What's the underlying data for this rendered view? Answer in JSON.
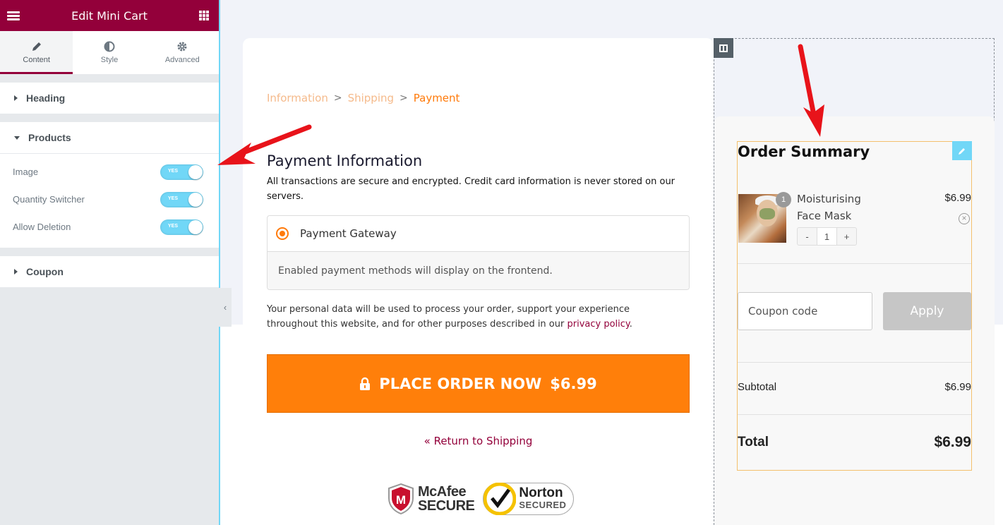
{
  "editor": {
    "title": "Edit Mini Cart",
    "tabs": [
      {
        "label": "Content",
        "icon": "pencil-icon",
        "active": true
      },
      {
        "label": "Style",
        "icon": "half-circle-icon",
        "active": false
      },
      {
        "label": "Advanced",
        "icon": "gear-icon",
        "active": false
      }
    ],
    "sections": {
      "heading": "Heading",
      "products": "Products",
      "coupon": "Coupon"
    },
    "controls": [
      {
        "label": "Image",
        "toggle": "YES",
        "on": true
      },
      {
        "label": "Quantity Switcher",
        "toggle": "YES",
        "on": true
      },
      {
        "label": "Allow Deletion",
        "toggle": "YES",
        "on": true
      }
    ],
    "accent_color": "#93003a",
    "toggle_color": "#71d7f7"
  },
  "checkout": {
    "breadcrumb": {
      "step1": "Information",
      "step2": "Shipping",
      "step3": "Payment",
      "sep": ">"
    },
    "payment_title": "Payment Information",
    "payment_desc": "All transactions are secure and encrypted. Credit card information is never stored on our servers.",
    "gateway_label": "Payment Gateway",
    "gateway_note": "Enabled payment methods will display on the frontend.",
    "privacy_text": "Your personal data will be used to process your order, support your experience throughout this website, and for other purposes described in our ",
    "privacy_link": "privacy policy",
    "privacy_end": ".",
    "place_order_label": "PLACE ORDER NOW",
    "place_order_amount": "$6.99",
    "return_link": "« Return to Shipping",
    "badges": {
      "mcafee_line1": "McAfee",
      "mcafee_line2": "SECURE",
      "norton_line1": "Norton",
      "norton_line2": "SECURED"
    },
    "button_color": "#ff7f0a"
  },
  "summary": {
    "title": "Order Summary",
    "product": {
      "name": "Moisturising Face Mask",
      "price": "$6.99",
      "quantity": "1",
      "minus": "-",
      "plus": "+"
    },
    "coupon_placeholder": "Coupon code",
    "apply_label": "Apply",
    "subtotal_label": "Subtotal",
    "subtotal_value": "$6.99",
    "total_label": "Total",
    "total_value": "$6.99"
  }
}
